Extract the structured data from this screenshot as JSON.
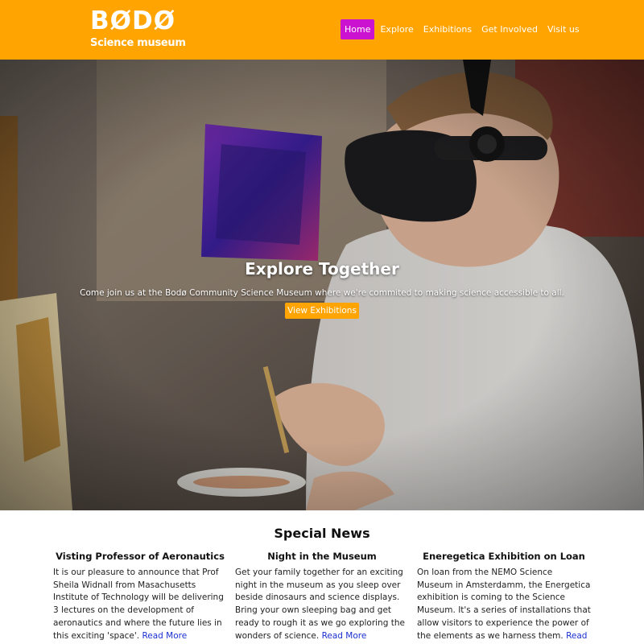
{
  "header": {
    "logo_word": "BØDØ",
    "logo_subtitle": "Science museum",
    "nav": [
      {
        "label": "Home",
        "active": true
      },
      {
        "label": "Explore",
        "active": false
      },
      {
        "label": "Exhibitions",
        "active": false
      },
      {
        "label": "Get Involved",
        "active": false
      },
      {
        "label": "Visit us",
        "active": false
      }
    ]
  },
  "hero": {
    "title": "Explore Together",
    "subtitle": "Come join us at the Bodø Community Science Museum where we're commited to making science accessible to all.",
    "button_label": "View Exhibitions"
  },
  "news": {
    "title": "Special News",
    "read_more_label": "Read More",
    "items": [
      {
        "title": "Visting Professor of Aeronautics",
        "body": "It is our pleasure to announce that Prof Sheila Widnall from Masachusetts Institute of Technology will be delivering 3 lectures on the development of aeronautics and where the future lies in this exciting 'space'."
      },
      {
        "title": "Night in the Museum",
        "body": "Get your family together for an exciting night in the museum as you sleep over beside dinosaurs and science displays. Bring your own sleeping bag and get ready to rough it as we go exploring the wonders of science."
      },
      {
        "title": "Eneregetica Exhibition on Loan",
        "body": "On loan from the NEMO Science Museum in Amsterdamm, the Energetica exhibition is coming to the Science Museum. It's a series of installations that allow visitors to experience the power of the elements as we harness them."
      }
    ]
  },
  "colors": {
    "header_bg": "#ffa401",
    "nav_active_bg": "#cc12d1",
    "button_bg": "#ffa401",
    "link": "#1a2fd1"
  }
}
